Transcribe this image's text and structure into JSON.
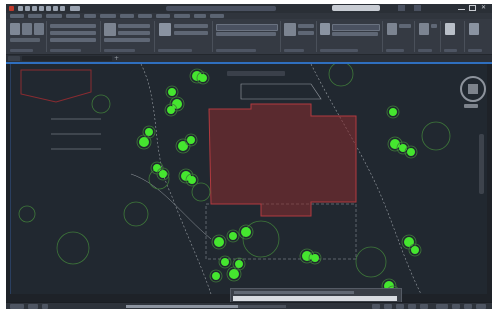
{
  "app": {
    "title": ""
  },
  "quick_access": {
    "icons": [
      "app-menu-icon",
      "new-icon",
      "open-icon",
      "save-icon",
      "save-as-icon",
      "plot-icon",
      "undo-icon",
      "redo-icon",
      "share-icon"
    ]
  },
  "search": {
    "placeholder": ""
  },
  "menu": {
    "tabs": [
      {
        "label": ""
      },
      {
        "label": ""
      },
      {
        "label": ""
      },
      {
        "label": ""
      },
      {
        "label": ""
      },
      {
        "label": ""
      },
      {
        "label": ""
      },
      {
        "label": ""
      },
      {
        "label": ""
      },
      {
        "label": ""
      },
      {
        "label": ""
      },
      {
        "label": ""
      }
    ]
  },
  "ribbon": {
    "panels": [
      {
        "label": ""
      },
      {
        "label": ""
      },
      {
        "label": ""
      },
      {
        "label": ""
      },
      {
        "label": ""
      },
      {
        "label": ""
      },
      {
        "label": ""
      },
      {
        "label": ""
      },
      {
        "label": ""
      },
      {
        "label": ""
      },
      {
        "label": ""
      }
    ]
  },
  "file_tabs": [
    {
      "label": ""
    },
    {
      "label": ""
    }
  ],
  "drawing": {
    "colors": {
      "background": "#212830",
      "building": "#8a2b30",
      "plant_fill": "#45e62f",
      "plant_outline": "#3f7a3a",
      "linework": "#9aa0a6",
      "property_line": "#8a2b30"
    }
  },
  "viewcube": {
    "icon": "viewcube-icon",
    "label": ""
  },
  "command_line": {
    "history": "",
    "placeholder": ""
  },
  "status_bar": {
    "model_tab": "",
    "coordinates": ""
  },
  "colors": {
    "ribbon_bg": "#353a43",
    "titlebar_bg": "#2a2f36",
    "accent": "#2f6fbf"
  }
}
